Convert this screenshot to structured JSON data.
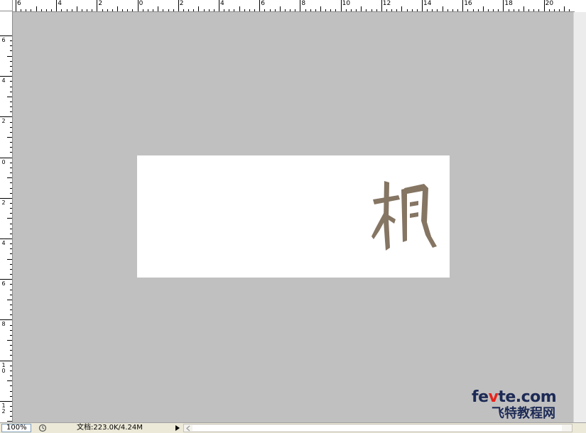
{
  "ruler": {
    "top_labels": [
      "6",
      "4",
      "2",
      "0",
      "2",
      "4",
      "6",
      "8",
      "10",
      "12",
      "14",
      "16",
      "18",
      "20"
    ],
    "left_labels": [
      "6",
      "4",
      "2",
      "0",
      "2",
      "4",
      "6",
      "8",
      "10",
      "12"
    ]
  },
  "document": {
    "background": "#ffffff",
    "artwork": "calligraphy character",
    "artwork_color": "#857563"
  },
  "canvas": {
    "background": "#c0c0c0"
  },
  "statusbar": {
    "zoom": "100%",
    "doc_info": "文档:223.0K/4.24M"
  },
  "watermark": {
    "line1_a": "fe",
    "line1_v": "v",
    "line1_b": "te.com",
    "line2": "飞特教程网",
    "accent": "#e8231b"
  }
}
